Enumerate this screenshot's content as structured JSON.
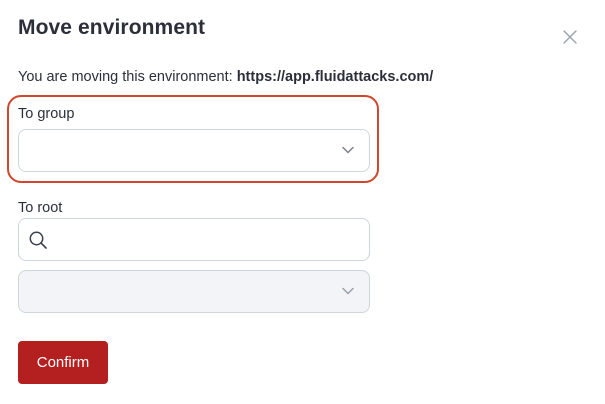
{
  "modal": {
    "title": "Move environment",
    "description_prefix": "You are moving this environment:",
    "environment_url": "https://app.fluidattacks.com/"
  },
  "group": {
    "label": "To group",
    "selected_value": ""
  },
  "root": {
    "label": "To root",
    "search_value": "",
    "selected_value": ""
  },
  "actions": {
    "confirm_label": "Confirm"
  },
  "colors": {
    "accent": "#b3201f",
    "highlight": "#d2462c",
    "disabled_field": "#f2f4f7"
  },
  "icons": {
    "close": "close-icon",
    "dropdown": "chevron-down-icon",
    "search": "search-icon"
  }
}
